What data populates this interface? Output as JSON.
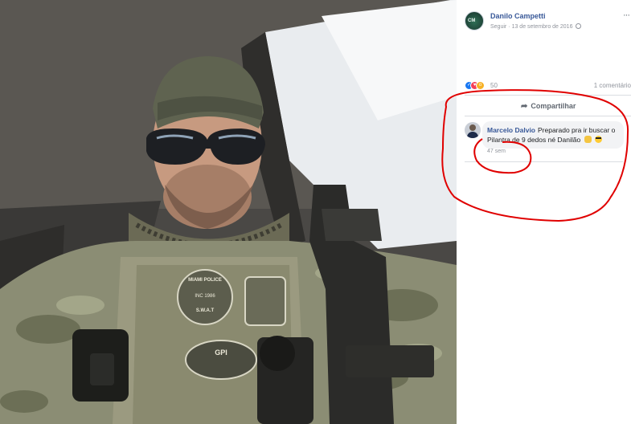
{
  "post": {
    "author": "Danilo Campetti",
    "avatar_text": "CM",
    "follow": "Seguir",
    "date": "13 de setembro de 2016",
    "more": "···",
    "reaction_count": "50",
    "comment_count": "1 comentário",
    "share_label": "Compartilhar"
  },
  "comment": {
    "author": "Marcelo Dalvio",
    "text": "Preparado pra ir buscar o Pilantra de 9 dedos né Danilão",
    "time": "47 sem"
  },
  "photo": {
    "patch_top": "MIAMI POLICE",
    "patch_mid": "INC 1986",
    "patch_bottom": "S.W.A.T",
    "patch_lower": "GPI"
  },
  "colors": {
    "link": "#385898",
    "annotation": "#e00000",
    "like": "#1877f2"
  },
  "icons": [
    "like-icon",
    "love-icon",
    "wow-icon",
    "share-icon",
    "globe-icon",
    "more-icon"
  ]
}
